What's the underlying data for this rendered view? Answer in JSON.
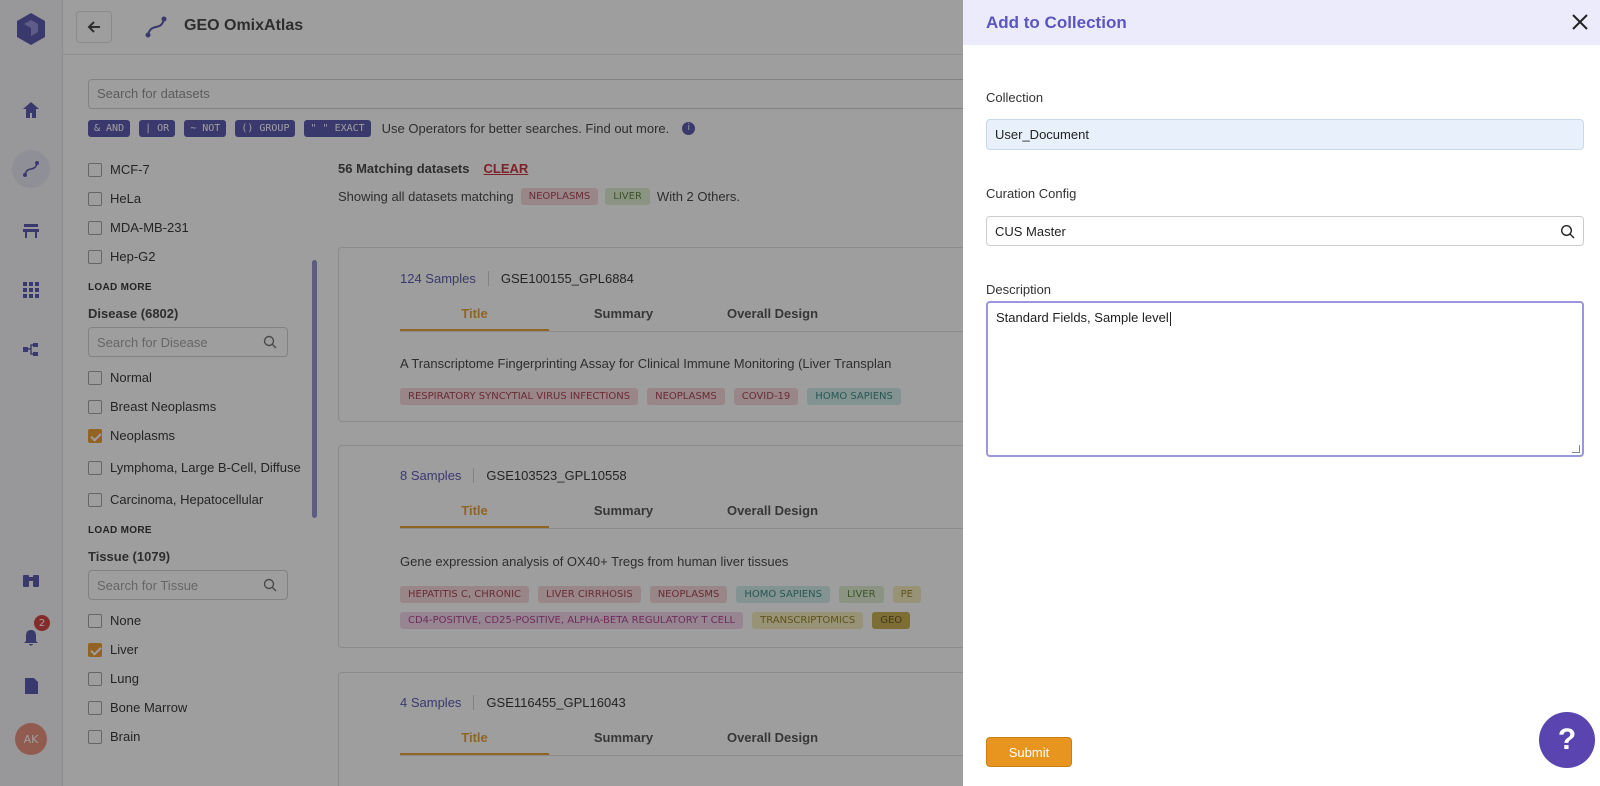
{
  "app": {
    "title": "GEO OmixAtlas"
  },
  "search": {
    "placeholder": "Search for datasets"
  },
  "operators": [
    "& AND",
    "| OR",
    "~ NOT",
    "() GROUP",
    "\" \" EXACT"
  ],
  "operators_hint": "Use Operators for better searches. Find out more.",
  "notifications": {
    "count": "2"
  },
  "user": {
    "initials": "AK"
  },
  "filters": {
    "cell_lines": [
      {
        "label": "MCF-7",
        "checked": false
      },
      {
        "label": "HeLa",
        "checked": false
      },
      {
        "label": "MDA-MB-231",
        "checked": false
      },
      {
        "label": "Hep-G2",
        "checked": false
      }
    ],
    "load_more": "LOAD MORE",
    "disease": {
      "heading": "Disease (6802)",
      "placeholder": "Search for Disease",
      "items": [
        "Normal",
        "Breast Neoplasms",
        "Neoplasms",
        "Lymphoma, Large B-Cell, Diffuse",
        "Carcinoma, Hepatocellular"
      ],
      "checked": [
        false,
        false,
        true,
        false,
        false
      ]
    },
    "tissue": {
      "heading": "Tissue (1079)",
      "placeholder": "Search for Tissue",
      "items": [
        "None",
        "Liver",
        "Lung",
        "Bone Marrow",
        "Brain"
      ],
      "checked": [
        false,
        true,
        false,
        false,
        false
      ]
    }
  },
  "results": {
    "match_text": "56 Matching datasets",
    "clear_label": "CLEAR",
    "showing_prefix": "Showing all datasets matching",
    "showing_chips": [
      "NEOPLASMS",
      "LIVER"
    ],
    "showing_suffix": "With 2 Others.",
    "tabs": [
      "Title",
      "Summary",
      "Overall Design"
    ],
    "datasets": [
      {
        "samples": "124 Samples",
        "id": "GSE100155_GPL6884",
        "title": "A Transcriptome Fingerprinting Assay for Clinical Immune Monitoring (Liver Transplan",
        "chips": [
          [
            "RESPIRATORY SYNCYTIAL VIRUS INFECTIONS",
            "red"
          ],
          [
            "NEOPLASMS",
            "red"
          ],
          [
            "COVID-19",
            "red"
          ],
          [
            "HOMO SAPIENS",
            "teal"
          ]
        ]
      },
      {
        "samples": "8 Samples",
        "id": "GSE103523_GPL10558",
        "title": "Gene expression analysis of OX40+ Tregs from human liver tissues",
        "chips": [
          [
            "HEPATITIS C, CHRONIC",
            "red"
          ],
          [
            "LIVER CIRRHOSIS",
            "red"
          ],
          [
            "NEOPLASMS",
            "red"
          ],
          [
            "HOMO SAPIENS",
            "teal"
          ],
          [
            "LIVER",
            "green"
          ],
          [
            "PE",
            "yellow"
          ]
        ],
        "chips2": [
          [
            "CD4-POSITIVE, CD25-POSITIVE, ALPHA-BETA REGULATORY T CELL",
            "pink"
          ],
          [
            "TRANSCRIPTOMICS",
            "yellow"
          ],
          [
            "GEO",
            "olive"
          ]
        ]
      },
      {
        "samples": "4 Samples",
        "id": "GSE116455_GPL16043"
      }
    ]
  },
  "panel": {
    "title": "Add to Collection",
    "collection_label": "Collection",
    "collection_value": "User_Document",
    "curation_label": "Curation Config",
    "curation_value": "CUS Master",
    "description_label": "Description",
    "description_value": "Standard Fields, Sample level",
    "submit_label": "Submit",
    "help_label": "?"
  },
  "colors": {
    "brand": "#4a48a8",
    "accent": "#e8951f",
    "panel_title": "#5a55c0"
  }
}
